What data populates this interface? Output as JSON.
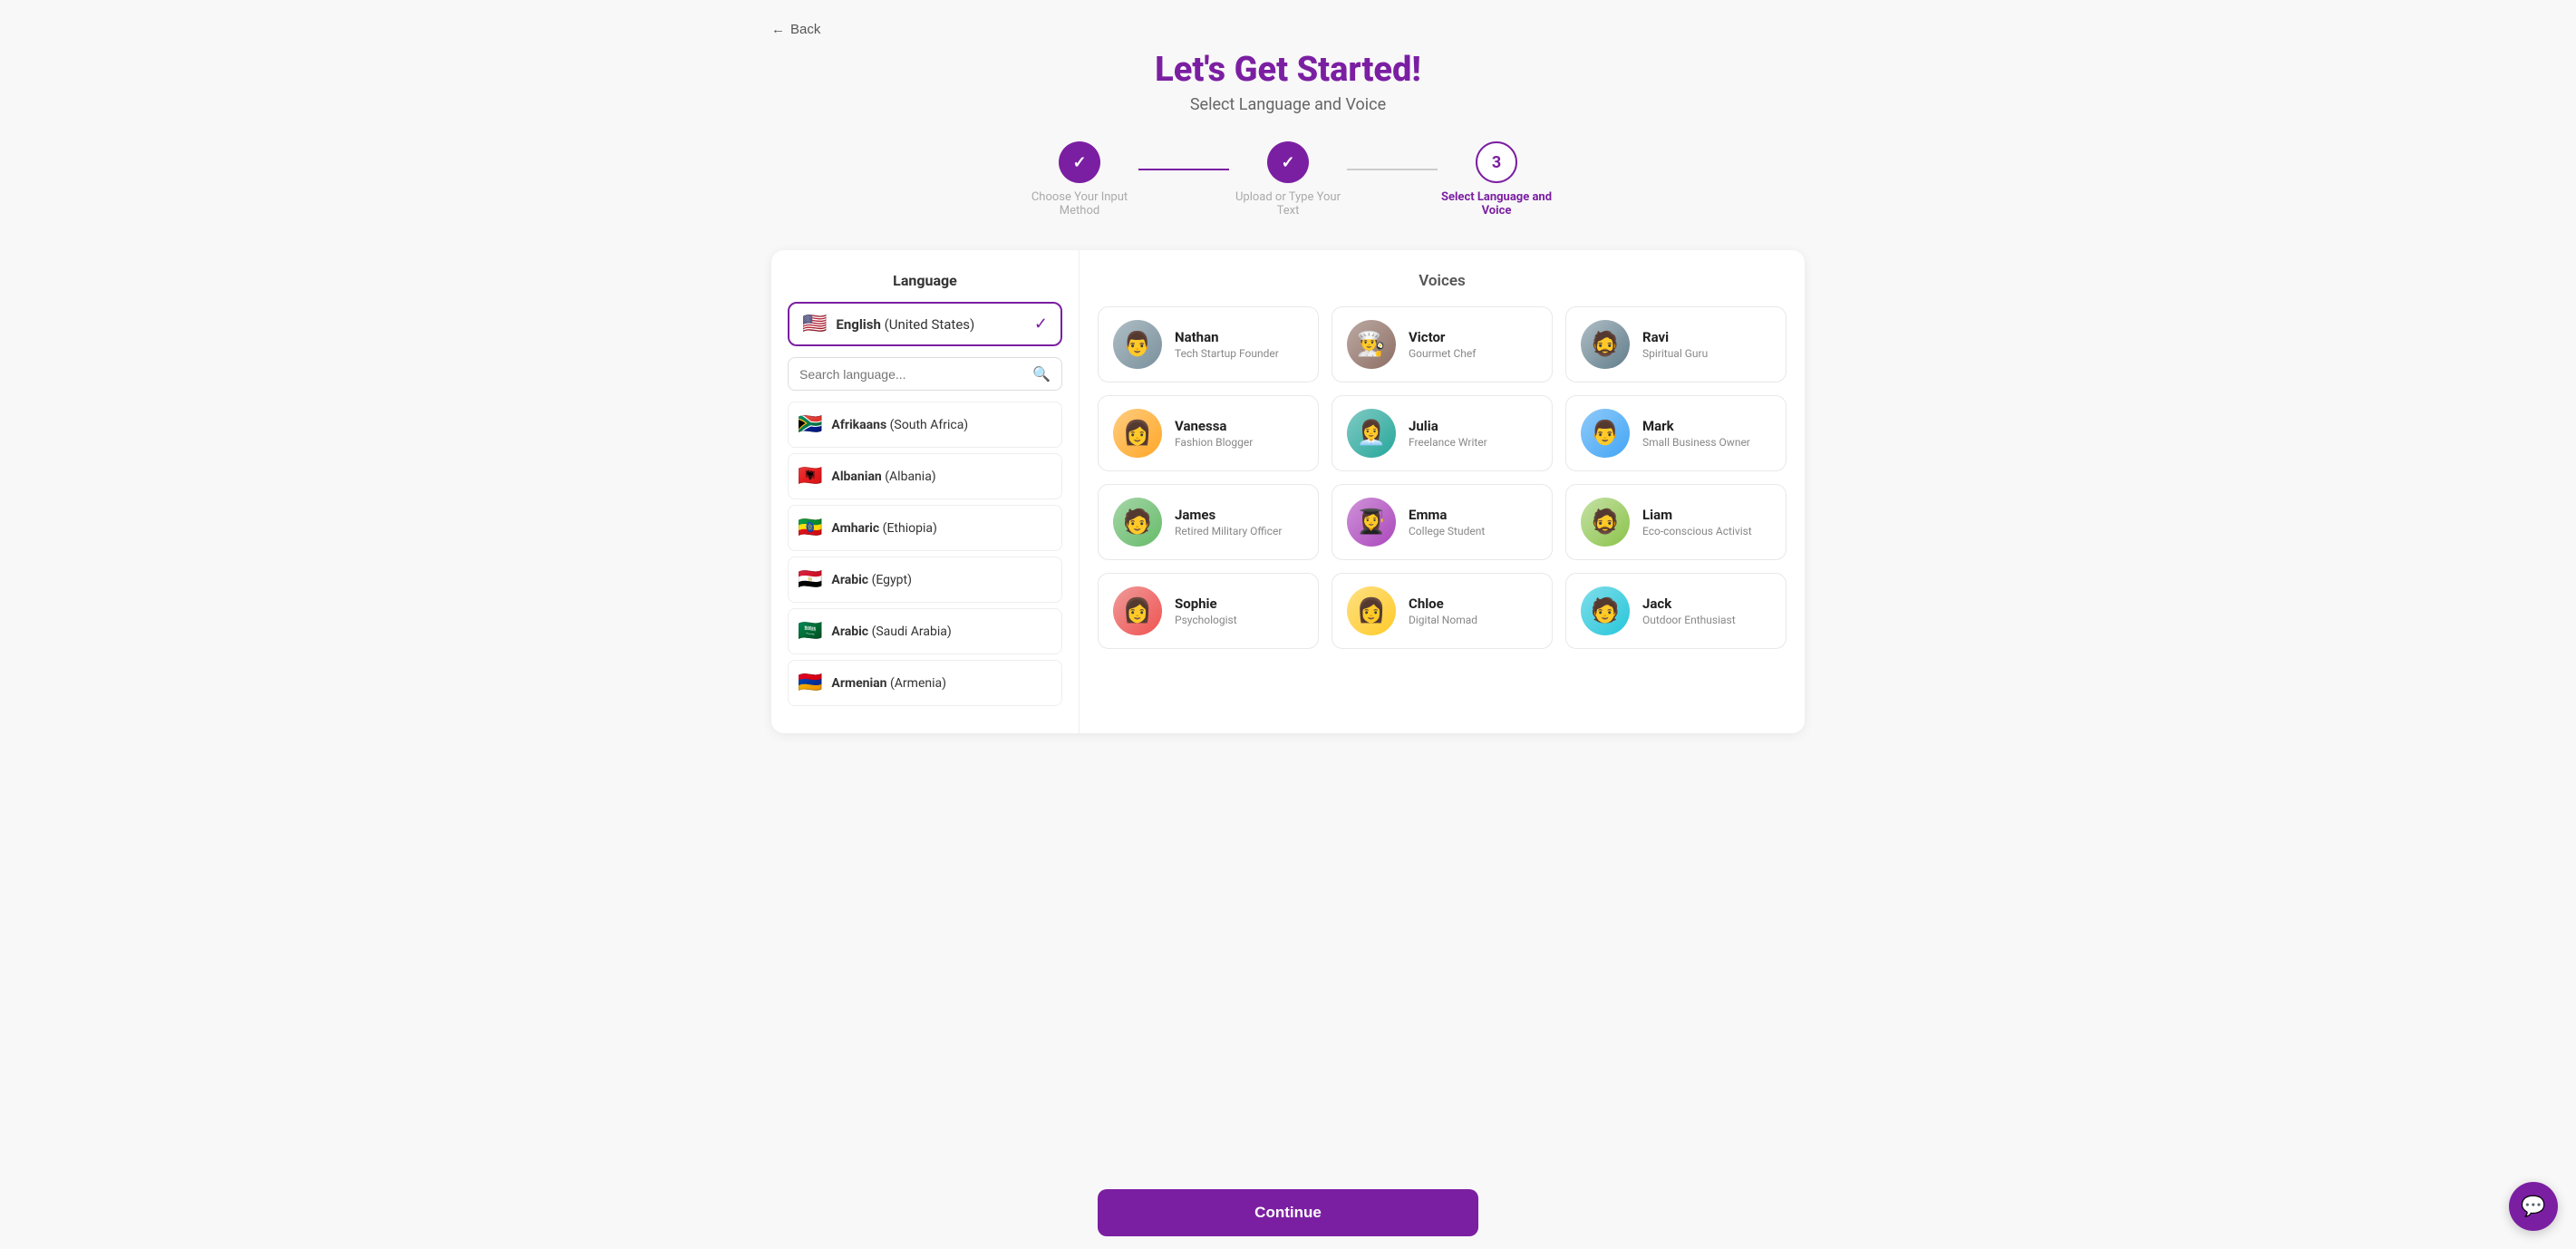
{
  "back_label": "Back",
  "page_title": "Let's Get Started!",
  "page_subtitle": "Select Language and Voice",
  "stepper": {
    "steps": [
      {
        "id": "step1",
        "label": "Choose Your Input Method",
        "state": "done",
        "number": "✓"
      },
      {
        "id": "step2",
        "label": "Upload or Type Your Text",
        "state": "done",
        "number": "✓"
      },
      {
        "id": "step3",
        "label": "Select Language and Voice",
        "state": "active",
        "number": "3"
      }
    ]
  },
  "language_panel": {
    "title": "Language",
    "search_placeholder": "Search language...",
    "selected": {
      "flag": "🇺🇸",
      "name": "English",
      "region": "(United States)"
    },
    "languages": [
      {
        "flag": "🇿🇦",
        "name": "Afrikaans",
        "region": "(South Africa)"
      },
      {
        "flag": "🇦🇱",
        "name": "Albanian",
        "region": "(Albania)"
      },
      {
        "flag": "🇪🇹",
        "name": "Amharic",
        "region": "(Ethiopia)"
      },
      {
        "flag": "🇪🇬",
        "name": "Arabic",
        "region": "(Egypt)"
      },
      {
        "flag": "🇸🇦",
        "name": "Arabic",
        "region": "(Saudi Arabia)"
      },
      {
        "flag": "🇦🇲",
        "name": "Armenian",
        "region": "(Armenia)"
      }
    ]
  },
  "voices_panel": {
    "title": "Voices",
    "voices": [
      {
        "id": "nathan",
        "name": "Nathan",
        "role": "Tech Startup Founder",
        "avatar_class": "av-1",
        "avatar_char": "👨"
      },
      {
        "id": "victor",
        "name": "Victor",
        "role": "Gourmet Chef",
        "avatar_class": "av-2",
        "avatar_char": "👨‍🍳"
      },
      {
        "id": "ravi",
        "name": "Ravi",
        "role": "Spiritual Guru",
        "avatar_class": "av-9",
        "avatar_char": "🧔"
      },
      {
        "id": "vanessa",
        "name": "Vanessa",
        "role": "Fashion Blogger",
        "avatar_class": "av-5",
        "avatar_char": "👩"
      },
      {
        "id": "julia",
        "name": "Julia",
        "role": "Freelance Writer",
        "avatar_class": "av-4",
        "avatar_char": "👩‍💼"
      },
      {
        "id": "mark",
        "name": "Mark",
        "role": "Small Business Owner",
        "avatar_class": "av-7",
        "avatar_char": "👨"
      },
      {
        "id": "james",
        "name": "James",
        "role": "Retired Military Officer",
        "avatar_class": "av-6",
        "avatar_char": "🧑"
      },
      {
        "id": "emma",
        "name": "Emma",
        "role": "College Student",
        "avatar_class": "av-3",
        "avatar_char": "👩‍🎓"
      },
      {
        "id": "liam",
        "name": "Liam",
        "role": "Eco-conscious Activist",
        "avatar_class": "av-11",
        "avatar_char": "🧔"
      },
      {
        "id": "sophie",
        "name": "Sophie",
        "role": "Psychologist",
        "avatar_class": "av-8",
        "avatar_char": "👩"
      },
      {
        "id": "chloe",
        "name": "Chloe",
        "role": "Digital Nomad",
        "avatar_class": "av-10",
        "avatar_char": "👩"
      },
      {
        "id": "jack",
        "name": "Jack",
        "role": "Outdoor Enthusiast",
        "avatar_class": "av-12",
        "avatar_char": "🧑"
      }
    ]
  },
  "continue_label": "Continue"
}
